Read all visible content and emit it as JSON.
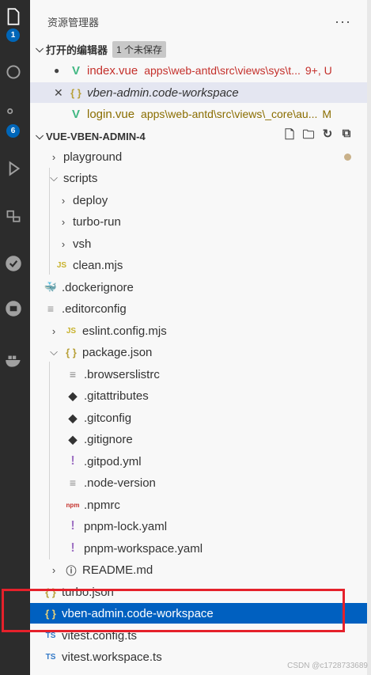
{
  "activity_bar": {
    "items": [
      {
        "icon": "files-icon",
        "badge": "1"
      },
      {
        "icon": "search-icon"
      },
      {
        "icon": "source-control-icon",
        "badge": "6"
      },
      {
        "icon": "run-debug-icon"
      },
      {
        "icon": "extensions-icon"
      },
      {
        "icon": "testing-icon"
      },
      {
        "icon": "remote-icon"
      },
      {
        "icon": "docker-icon"
      }
    ]
  },
  "explorer": {
    "title": "资源管理器",
    "more": "···",
    "open_editors": {
      "label": "打开的编辑器",
      "unsaved": "1 个未保存",
      "items": [
        {
          "name": "index.vue",
          "path": "apps\\web-antd\\src\\views\\sys\\t...",
          "status": "9+, U",
          "icon": "vue-icon"
        },
        {
          "name": "vben-admin.code-workspace",
          "path": "",
          "status": "",
          "icon": "json-icon"
        },
        {
          "name": "login.vue",
          "path": "apps\\web-antd\\src\\views\\_core\\au...",
          "status": "M",
          "icon": "vue-icon"
        }
      ]
    },
    "folder": {
      "label": "VUE-VBEN-ADMIN-4",
      "tree": [
        {
          "name": "playground"
        },
        {
          "name": "scripts"
        },
        {
          "name": "deploy"
        },
        {
          "name": "turbo-run"
        },
        {
          "name": "vsh"
        },
        {
          "name": "clean.mjs",
          "icon": "JS"
        },
        {
          "name": ".dockerignore"
        },
        {
          "name": ".editorconfig"
        },
        {
          "name": "eslint.config.mjs",
          "icon": "JS"
        },
        {
          "name": "package.json",
          "icon": "{ }"
        },
        {
          "name": ".browserslistrc"
        },
        {
          "name": ".gitattributes"
        },
        {
          "name": ".gitconfig"
        },
        {
          "name": ".gitignore"
        },
        {
          "name": ".gitpod.yml",
          "icon": "!"
        },
        {
          "name": ".node-version"
        },
        {
          "name": ".npmrc",
          "icon": "npm"
        },
        {
          "name": "pnpm-lock.yaml",
          "icon": "!"
        },
        {
          "name": "pnpm-workspace.yaml",
          "icon": "!"
        },
        {
          "name": "README.md",
          "icon": "ⓘ"
        },
        {
          "name": "turbo.json",
          "icon": "{ }"
        },
        {
          "name": "vben-admin.code-workspace",
          "icon": "{ }"
        },
        {
          "name": "vitest.config.ts",
          "icon": "TS"
        },
        {
          "name": "vitest.workspace.ts",
          "icon": "TS"
        }
      ]
    }
  },
  "watermark": "CSDN @c1728733689",
  "colors": {
    "selection": "#0060c0",
    "highlight_box": "#e5212b",
    "badge": "#0066b8"
  }
}
